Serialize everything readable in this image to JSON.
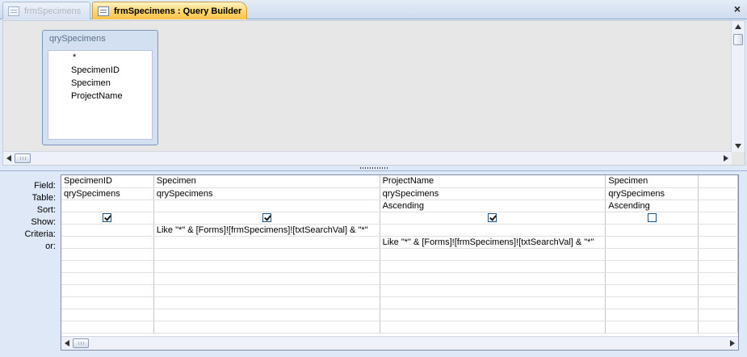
{
  "tabs": [
    {
      "label": "frmSpecimens",
      "active": false,
      "icon": "form-icon"
    },
    {
      "label": "frmSpecimens : Query Builder",
      "active": true,
      "icon": "query-icon"
    }
  ],
  "close_label": "×",
  "table_box": {
    "title": "qrySpecimens",
    "fields": [
      "*",
      "SpecimenID",
      "Specimen",
      "ProjectName"
    ]
  },
  "row_labels": [
    "Field:",
    "Table:",
    "Sort:",
    "Show:",
    "Criteria:",
    "or:"
  ],
  "columns": [
    {
      "field": "SpecimenID",
      "table": "qrySpecimens",
      "sort": "",
      "show": true,
      "criteria": "",
      "or": ""
    },
    {
      "field": "Specimen",
      "table": "qrySpecimens",
      "sort": "",
      "show": true,
      "criteria": "Like \"*\" & [Forms]![frmSpecimens]![txtSearchVal] & \"*\"",
      "or": ""
    },
    {
      "field": "ProjectName",
      "table": "qrySpecimens",
      "sort": "Ascending",
      "show": true,
      "criteria": "",
      "or": "Like \"*\" & [Forms]![frmSpecimens]![txtSearchVal] & \"*\""
    },
    {
      "field": "Specimen",
      "table": "qrySpecimens",
      "sort": "Ascending",
      "show": false,
      "criteria": "",
      "or": ""
    },
    {
      "field": "",
      "table": "",
      "sort": "",
      "show": null,
      "criteria": "",
      "or": ""
    }
  ],
  "colors": {
    "active_tab": "#fdc24a",
    "workspace": "#dfe8f6",
    "pane": "#e7e7e7"
  }
}
